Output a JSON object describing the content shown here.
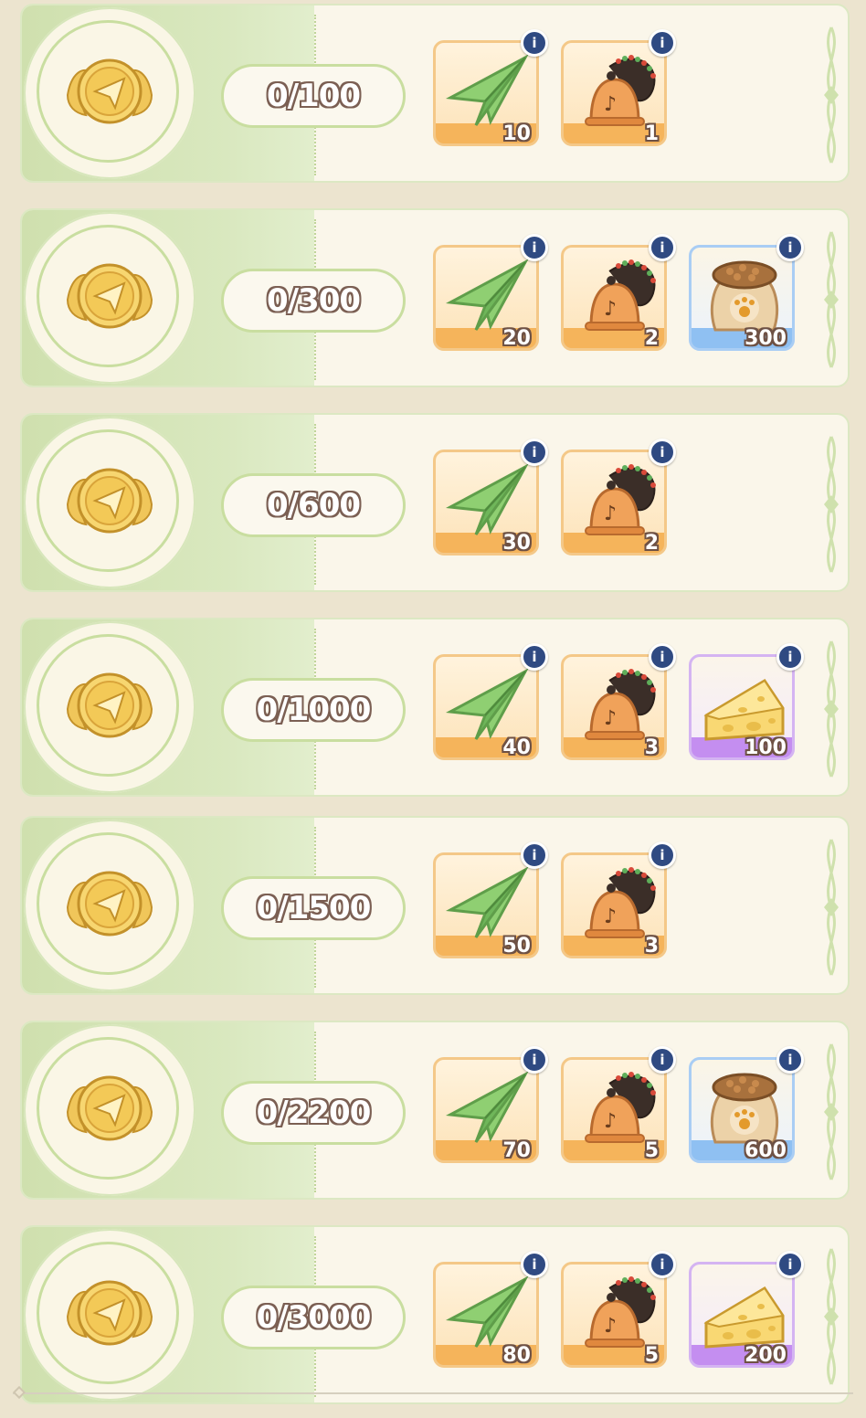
{
  "colors": {
    "card_bg": "#faf6ea",
    "accent_green": "#c9dea0",
    "orange_tier": "#f5b45b",
    "blue_tier": "#8fc0f2",
    "purple_tier": "#c48ef0",
    "info_badge": "#2f4a82"
  },
  "milestones": [
    {
      "progress": "0/100",
      "rewards": [
        {
          "icon": "paper-plane-icon",
          "tier": "orange",
          "qty": "10"
        },
        {
          "icon": "bell-icon",
          "tier": "orange",
          "qty": "1"
        }
      ]
    },
    {
      "progress": "0/300",
      "rewards": [
        {
          "icon": "paper-plane-icon",
          "tier": "orange",
          "qty": "20"
        },
        {
          "icon": "bell-icon",
          "tier": "orange",
          "qty": "2"
        },
        {
          "icon": "pet-food-bag-icon",
          "tier": "blue",
          "qty": "300"
        }
      ]
    },
    {
      "progress": "0/600",
      "rewards": [
        {
          "icon": "paper-plane-icon",
          "tier": "orange",
          "qty": "30"
        },
        {
          "icon": "bell-icon",
          "tier": "orange",
          "qty": "2"
        }
      ]
    },
    {
      "progress": "0/1000",
      "rewards": [
        {
          "icon": "paper-plane-icon",
          "tier": "orange",
          "qty": "40"
        },
        {
          "icon": "bell-icon",
          "tier": "orange",
          "qty": "3"
        },
        {
          "icon": "cheese-icon",
          "tier": "purple",
          "qty": "100"
        }
      ]
    },
    {
      "progress": "0/1500",
      "rewards": [
        {
          "icon": "paper-plane-icon",
          "tier": "orange",
          "qty": "50"
        },
        {
          "icon": "bell-icon",
          "tier": "orange",
          "qty": "3"
        }
      ]
    },
    {
      "progress": "0/2200",
      "rewards": [
        {
          "icon": "paper-plane-icon",
          "tier": "orange",
          "qty": "70"
        },
        {
          "icon": "bell-icon",
          "tier": "orange",
          "qty": "5"
        },
        {
          "icon": "pet-food-bag-icon",
          "tier": "blue",
          "qty": "600"
        }
      ]
    },
    {
      "progress": "0/3000",
      "rewards": [
        {
          "icon": "paper-plane-icon",
          "tier": "orange",
          "qty": "80"
        },
        {
          "icon": "bell-icon",
          "tier": "orange",
          "qty": "5"
        },
        {
          "icon": "cheese-icon",
          "tier": "purple",
          "qty": "200"
        }
      ]
    }
  ]
}
